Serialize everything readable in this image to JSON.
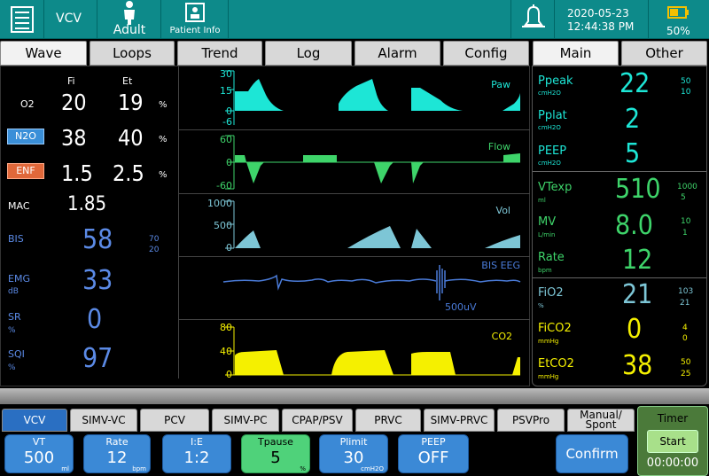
{
  "topbar": {
    "mode": "VCV",
    "patient_type": "Adult",
    "patient_info": "Patient Info",
    "date": "2020-05-23",
    "time": "12:44:38 PM",
    "battery": "50%"
  },
  "tabs": {
    "wave": "Wave",
    "loops": "Loops",
    "trend": "Trend",
    "log": "Log",
    "alarm": "Alarm",
    "config": "Config",
    "main": "Main",
    "other": "Other"
  },
  "gas": {
    "fi_header": "Fi",
    "et_header": "Et",
    "o2": {
      "label": "O2",
      "fi": "20",
      "et": "19",
      "unit": "%"
    },
    "n2o": {
      "label": "N2O",
      "fi": "38",
      "et": "40",
      "unit": "%"
    },
    "enf": {
      "label": "ENF",
      "fi": "1.5",
      "et": "2.5",
      "unit": "%"
    },
    "mac": {
      "label": "MAC",
      "value": "1.85"
    },
    "bis": {
      "label": "BIS",
      "value": "58",
      "high": "70",
      "low": "20"
    },
    "emg": {
      "label": "EMG",
      "unit": "dB",
      "value": "33"
    },
    "sr": {
      "label": "SR",
      "unit": "%",
      "value": "0"
    },
    "sqi": {
      "label": "SQI",
      "unit": "%",
      "value": "97"
    }
  },
  "waves": {
    "paw": {
      "label": "Paw",
      "ticks": [
        "30",
        "15",
        "0",
        "-6"
      ],
      "color": "#1de6d6"
    },
    "flow": {
      "label": "Flow",
      "ticks": [
        "60",
        "0",
        "-60"
      ],
      "color": "#3ed46a"
    },
    "vol": {
      "label": "Vol",
      "ticks": [
        "1000",
        "500",
        "0"
      ],
      "color": "#7dc6d6"
    },
    "bis_eeg": {
      "label": "BIS EEG",
      "scale": "500uV",
      "color": "#4a7bd8"
    },
    "co2": {
      "label": "CO2",
      "ticks": [
        "80",
        "40",
        "0"
      ],
      "color": "#f5f000"
    }
  },
  "main": {
    "ppeak": {
      "label": "Ppeak",
      "unit": "cmH2O",
      "value": "22",
      "high": "50",
      "low": "10"
    },
    "pplat": {
      "label": "Pplat",
      "unit": "cmH2O",
      "value": "2"
    },
    "peep": {
      "label": "PEEP",
      "unit": "cmH2O",
      "value": "5"
    },
    "vtexp": {
      "label": "VTexp",
      "unit": "ml",
      "value": "510",
      "high": "1000",
      "low": "5"
    },
    "mv": {
      "label": "MV",
      "unit": "L/min",
      "value": "8.0",
      "high": "10",
      "low": "1"
    },
    "rate": {
      "label": "Rate",
      "unit": "bpm",
      "value": "12"
    },
    "fio2": {
      "label": "FiO2",
      "unit": "%",
      "value": "21",
      "high": "103",
      "low": "21"
    },
    "fico2": {
      "label": "FiCO2",
      "unit": "mmHg",
      "value": "0",
      "high": "4",
      "low": "0"
    },
    "etco2": {
      "label": "EtCO2",
      "unit": "mmHg",
      "value": "38",
      "high": "50",
      "low": "25"
    }
  },
  "modes": [
    "VCV",
    "SIMV-VC",
    "PCV",
    "SIMV-PC",
    "CPAP/PSV",
    "PRVC",
    "SIMV-PRVC",
    "PSVPro",
    "Manual/ Spont"
  ],
  "params": {
    "vt": {
      "label": "VT",
      "value": "500",
      "unit": "ml"
    },
    "rate": {
      "label": "Rate",
      "value": "12",
      "unit": "bpm"
    },
    "ie": {
      "label": "I:E",
      "value": "1:2"
    },
    "tpause": {
      "label": "Tpause",
      "value": "5",
      "unit": "%"
    },
    "plimit": {
      "label": "Plimit",
      "value": "30",
      "unit": "cmH2O"
    },
    "peep": {
      "label": "PEEP",
      "value": "OFF"
    }
  },
  "confirm": "Confirm",
  "timer": {
    "label": "Timer",
    "start": "Start",
    "value": "00:00:00"
  },
  "colors": {
    "teal": "#0d8a8a",
    "cyan": "#1de6d6",
    "green": "#3ed46a",
    "blue": "#4a7bd8",
    "yellow": "#f5f000"
  }
}
